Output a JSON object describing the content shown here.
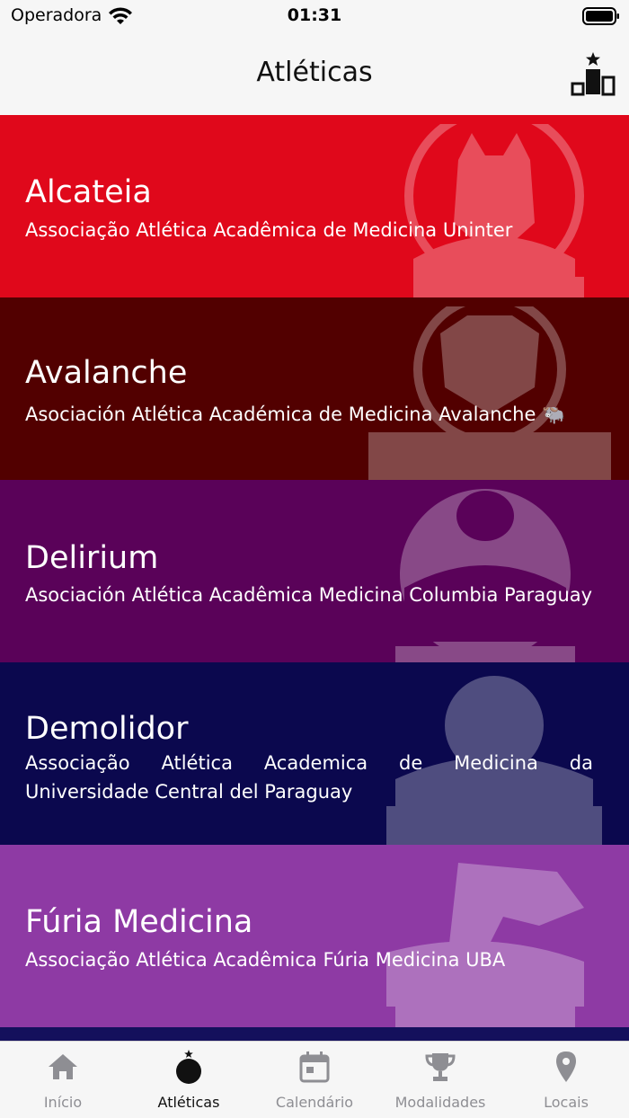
{
  "status": {
    "carrier": "Operadora",
    "time": "01:31"
  },
  "header": {
    "title": "Atléticas",
    "ranking_icon": "podium-icon"
  },
  "athletics": [
    {
      "name": "Alcateia",
      "description": "Associação Atlética Acadêmica de Medicina Uninter",
      "color": "#e0081b",
      "logo_icon": "wolf-mascot-logo"
    },
    {
      "name": "Avalanche",
      "description": "Asociación Atlética Académica de Medicina Avalanche 🐃",
      "color": "#520000",
      "logo_icon": "bison-mascot-logo"
    },
    {
      "name": "Delirium",
      "description": "Asociación Atlética Acadêmica Medicina Columbia Paraguay",
      "color": "#5a0259",
      "logo_icon": "skull-mascot-logo"
    },
    {
      "name": "Demolidor",
      "description": "Associação Atlética Academica de Medicina da Universidade Central del Paraguay",
      "color": "#0b084e",
      "logo_icon": "lion-mascot-logo"
    },
    {
      "name": "Fúria Medicina",
      "description": "Associação Atlética Acadêmica Fúria Medicina UBA",
      "color": "#8e3aa4",
      "logo_icon": "dinosaur-mascot-logo"
    }
  ],
  "tabs": [
    {
      "label": "Início",
      "icon": "home-icon",
      "active": false
    },
    {
      "label": "Atléticas",
      "icon": "bomb-icon",
      "active": true
    },
    {
      "label": "Calendário",
      "icon": "calendar-icon",
      "active": false
    },
    {
      "label": "Modalidades",
      "icon": "trophy-icon",
      "active": false
    },
    {
      "label": "Locais",
      "icon": "location-pin-icon",
      "active": false
    }
  ]
}
